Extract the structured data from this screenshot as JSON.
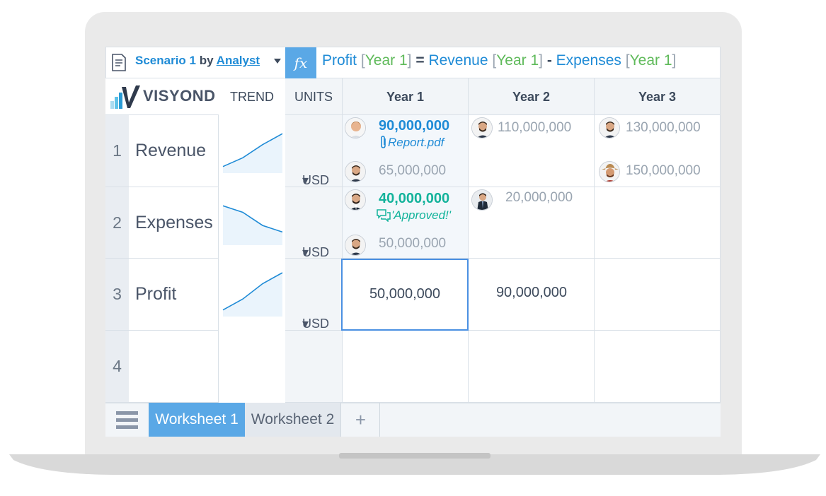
{
  "scenario": {
    "name": "Scenario 1",
    "by": "by",
    "user": "Analyst"
  },
  "formula": {
    "fx": "fx",
    "parts": [
      {
        "t": "Profit ",
        "c": "f-blue"
      },
      {
        "t": "[",
        "c": "f-gray"
      },
      {
        "t": "Year 1",
        "c": "f-green"
      },
      {
        "t": "]",
        "c": "f-gray"
      },
      {
        "t": " = ",
        "c": "f-op"
      },
      {
        "t": "Revenue ",
        "c": "f-blue"
      },
      {
        "t": "[",
        "c": "f-gray"
      },
      {
        "t": "Year 1",
        "c": "f-green"
      },
      {
        "t": "]",
        "c": "f-gray"
      },
      {
        "t": " - ",
        "c": "f-op"
      },
      {
        "t": "Expenses ",
        "c": "f-blue"
      },
      {
        "t": "[",
        "c": "f-gray"
      },
      {
        "t": "Year 1",
        "c": "f-green"
      },
      {
        "t": "]",
        "c": "f-gray"
      }
    ]
  },
  "logo": {
    "text": "VISYOND"
  },
  "headers": {
    "trend": "TREND",
    "units": "UNITS",
    "years": [
      "Year 1",
      "Year 2",
      "Year 3"
    ]
  },
  "rows": [
    {
      "num": "1",
      "name": "Revenue",
      "unit": "USD",
      "trend": [
        0.15,
        0.35,
        0.65,
        0.9
      ]
    },
    {
      "num": "2",
      "name": "Expenses",
      "unit": "USD",
      "trend": [
        0.9,
        0.75,
        0.45,
        0.3
      ]
    },
    {
      "num": "3",
      "name": "Profit",
      "unit": "USD",
      "trend": [
        0.15,
        0.4,
        0.75,
        1.0
      ]
    },
    {
      "num": "4",
      "name": ""
    }
  ],
  "cells": {
    "r1": {
      "y1_main": "90,000,000",
      "y1_attach": "Report.pdf",
      "y1_alt": "65,000,000",
      "y2_val": "110,000,000",
      "y3_val": "130,000,000",
      "y3_alt": "150,000,000"
    },
    "r2": {
      "y1_main": "40,000,000",
      "y1_note": "'Approved!'",
      "y1_alt": "50,000,000",
      "y2_val": "20,000,000"
    },
    "r3": {
      "y1_val": "50,000,000",
      "y2_val": "90,000,000"
    }
  },
  "tabs": {
    "sheet1": "Worksheet 1",
    "sheet2": "Worksheet 2",
    "add": "+"
  },
  "colors": {
    "accent": "#1f8bd6",
    "green": "#13b39b",
    "formula_green": "#5fba5a",
    "tab_active": "#5aa8e6"
  }
}
